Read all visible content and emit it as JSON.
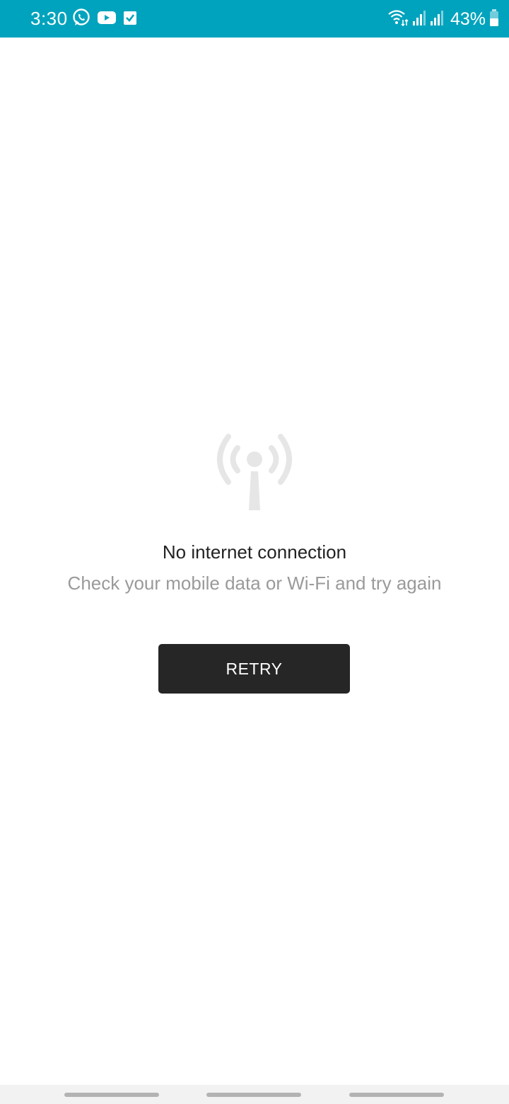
{
  "status_bar": {
    "time": "3:30",
    "battery_percent": "43%",
    "background_color": "#00a3bd",
    "left_icons": [
      "whatsapp-icon",
      "youtube-icon",
      "checkbox-icon"
    ],
    "right_icons": [
      "wifi-data-icon",
      "signal-icon",
      "signal-icon",
      "battery-icon"
    ]
  },
  "main": {
    "icon": "no-signal-antenna-icon",
    "title": "No internet connection",
    "subtitle": "Check your mobile data or Wi-Fi and try again",
    "retry_label": "RETRY"
  },
  "nav_bar": {
    "items": [
      "recent-apps",
      "home",
      "back"
    ]
  }
}
